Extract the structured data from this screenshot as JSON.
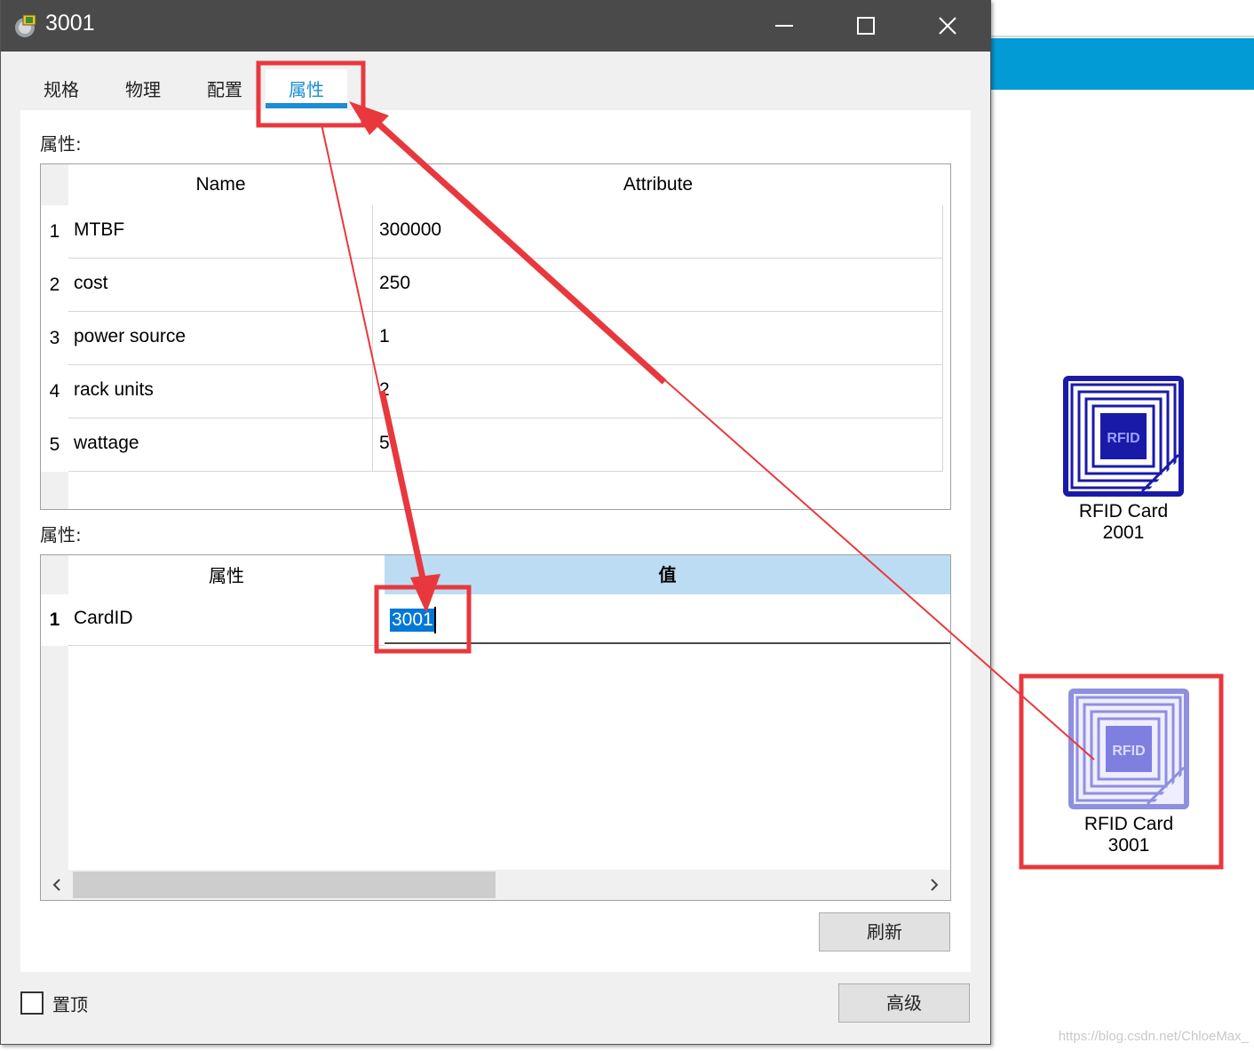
{
  "window": {
    "title": "3001",
    "controls": [
      "minimize",
      "maximize",
      "close"
    ]
  },
  "tabs": [
    {
      "label": "规格",
      "active": false
    },
    {
      "label": "物理",
      "active": false
    },
    {
      "label": "配置",
      "active": false
    },
    {
      "label": "属性",
      "active": true
    }
  ],
  "section1": {
    "label": "属性:",
    "columns": [
      "Name",
      "Attribute"
    ],
    "rows": [
      {
        "num": "1",
        "name": "MTBF",
        "value": "300000"
      },
      {
        "num": "2",
        "name": "cost",
        "value": "250"
      },
      {
        "num": "3",
        "name": "power source",
        "value": "1"
      },
      {
        "num": "4",
        "name": "rack units",
        "value": "2"
      },
      {
        "num": "5",
        "name": "wattage",
        "value": "5"
      }
    ]
  },
  "section2": {
    "label": "属性:",
    "columns": [
      "属性",
      "值"
    ],
    "rows": [
      {
        "num": "1",
        "name": "CardID",
        "value": "3001"
      }
    ]
  },
  "buttons": {
    "refresh": "刷新",
    "advanced": "高级"
  },
  "checkbox": {
    "label": "置顶",
    "checked": false
  },
  "workspace": {
    "devices": [
      {
        "line1": "RFID Card",
        "line2": "2001",
        "badge": "RFID",
        "selected": false
      },
      {
        "line1": "RFID Card",
        "line2": "3001",
        "badge": "RFID",
        "selected": true
      }
    ],
    "accent_color": "#039bd6"
  },
  "colors": {
    "titlebar": "#4a4a4a",
    "active_tab": "#1b8fd2",
    "annotation_red": "#e8383d",
    "selection": "#0078d7"
  },
  "watermark": "https://blog.csdn.net/ChloeMax_"
}
